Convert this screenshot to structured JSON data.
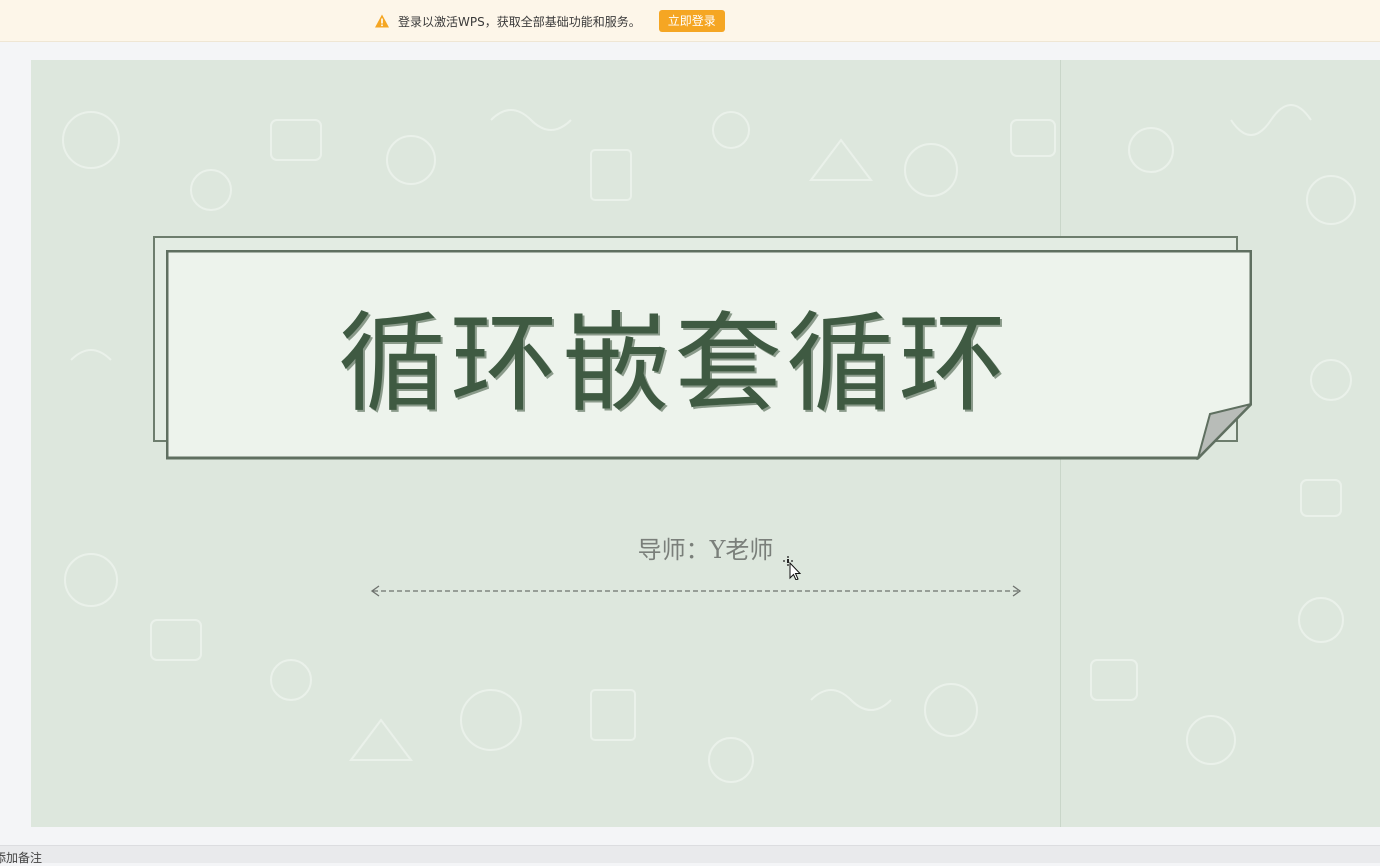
{
  "notice": {
    "message": "登录以激活WPS，获取全部基础功能和服务。",
    "login_button": "立即登录",
    "warn_color": "#f5a623"
  },
  "slide": {
    "title": "循环嵌套循环",
    "subtitle": "导师：Y老师",
    "background_color": "#dde7dd",
    "title_color": "#3f5a42"
  },
  "notes": {
    "placeholder": "添加备注"
  }
}
